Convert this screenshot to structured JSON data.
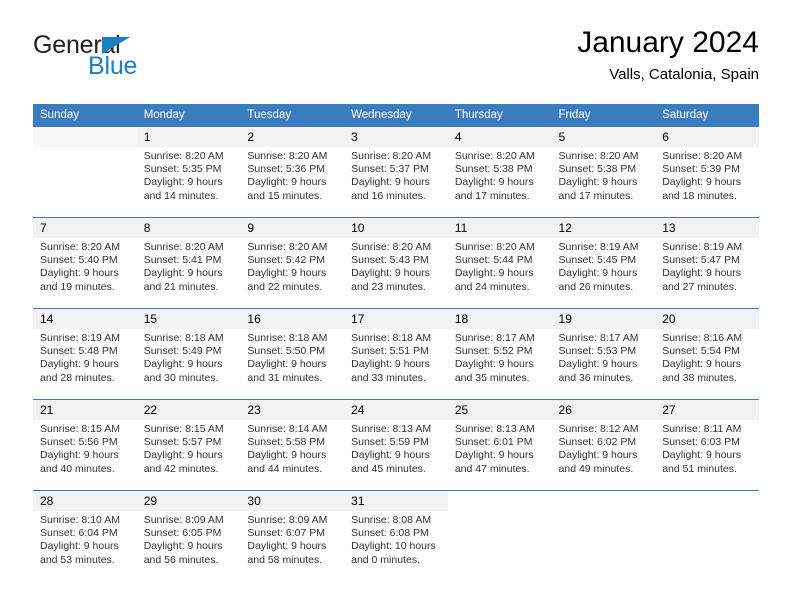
{
  "brand": {
    "name_part1": "General",
    "name_part2": "Blue",
    "triangle_color": "#1b7fc3"
  },
  "header": {
    "title": "January 2024",
    "location": "Valls, Catalonia, Spain"
  },
  "theme": {
    "header_bg": "#3b7cbf",
    "daynum_bg": "#f2f2f2",
    "text": "#333333"
  },
  "weekdays": [
    "Sunday",
    "Monday",
    "Tuesday",
    "Wednesday",
    "Thursday",
    "Friday",
    "Saturday"
  ],
  "labels": {
    "sunrise_prefix": "Sunrise:",
    "sunset_prefix": "Sunset:",
    "daylight_prefix": "Daylight:"
  },
  "weeks": [
    [
      {
        "day": "",
        "sunrise": "",
        "sunset": "",
        "daylight_line1": "",
        "daylight_line2": ""
      },
      {
        "day": "1",
        "sunrise": "Sunrise: 8:20 AM",
        "sunset": "Sunset: 5:35 PM",
        "daylight_line1": "Daylight: 9 hours",
        "daylight_line2": "and 14 minutes."
      },
      {
        "day": "2",
        "sunrise": "Sunrise: 8:20 AM",
        "sunset": "Sunset: 5:36 PM",
        "daylight_line1": "Daylight: 9 hours",
        "daylight_line2": "and 15 minutes."
      },
      {
        "day": "3",
        "sunrise": "Sunrise: 8:20 AM",
        "sunset": "Sunset: 5:37 PM",
        "daylight_line1": "Daylight: 9 hours",
        "daylight_line2": "and 16 minutes."
      },
      {
        "day": "4",
        "sunrise": "Sunrise: 8:20 AM",
        "sunset": "Sunset: 5:38 PM",
        "daylight_line1": "Daylight: 9 hours",
        "daylight_line2": "and 17 minutes."
      },
      {
        "day": "5",
        "sunrise": "Sunrise: 8:20 AM",
        "sunset": "Sunset: 5:38 PM",
        "daylight_line1": "Daylight: 9 hours",
        "daylight_line2": "and 17 minutes."
      },
      {
        "day": "6",
        "sunrise": "Sunrise: 8:20 AM",
        "sunset": "Sunset: 5:39 PM",
        "daylight_line1": "Daylight: 9 hours",
        "daylight_line2": "and 18 minutes."
      }
    ],
    [
      {
        "day": "7",
        "sunrise": "Sunrise: 8:20 AM",
        "sunset": "Sunset: 5:40 PM",
        "daylight_line1": "Daylight: 9 hours",
        "daylight_line2": "and 19 minutes."
      },
      {
        "day": "8",
        "sunrise": "Sunrise: 8:20 AM",
        "sunset": "Sunset: 5:41 PM",
        "daylight_line1": "Daylight: 9 hours",
        "daylight_line2": "and 21 minutes."
      },
      {
        "day": "9",
        "sunrise": "Sunrise: 8:20 AM",
        "sunset": "Sunset: 5:42 PM",
        "daylight_line1": "Daylight: 9 hours",
        "daylight_line2": "and 22 minutes."
      },
      {
        "day": "10",
        "sunrise": "Sunrise: 8:20 AM",
        "sunset": "Sunset: 5:43 PM",
        "daylight_line1": "Daylight: 9 hours",
        "daylight_line2": "and 23 minutes."
      },
      {
        "day": "11",
        "sunrise": "Sunrise: 8:20 AM",
        "sunset": "Sunset: 5:44 PM",
        "daylight_line1": "Daylight: 9 hours",
        "daylight_line2": "and 24 minutes."
      },
      {
        "day": "12",
        "sunrise": "Sunrise: 8:19 AM",
        "sunset": "Sunset: 5:45 PM",
        "daylight_line1": "Daylight: 9 hours",
        "daylight_line2": "and 26 minutes."
      },
      {
        "day": "13",
        "sunrise": "Sunrise: 8:19 AM",
        "sunset": "Sunset: 5:47 PM",
        "daylight_line1": "Daylight: 9 hours",
        "daylight_line2": "and 27 minutes."
      }
    ],
    [
      {
        "day": "14",
        "sunrise": "Sunrise: 8:19 AM",
        "sunset": "Sunset: 5:48 PM",
        "daylight_line1": "Daylight: 9 hours",
        "daylight_line2": "and 28 minutes."
      },
      {
        "day": "15",
        "sunrise": "Sunrise: 8:18 AM",
        "sunset": "Sunset: 5:49 PM",
        "daylight_line1": "Daylight: 9 hours",
        "daylight_line2": "and 30 minutes."
      },
      {
        "day": "16",
        "sunrise": "Sunrise: 8:18 AM",
        "sunset": "Sunset: 5:50 PM",
        "daylight_line1": "Daylight: 9 hours",
        "daylight_line2": "and 31 minutes."
      },
      {
        "day": "17",
        "sunrise": "Sunrise: 8:18 AM",
        "sunset": "Sunset: 5:51 PM",
        "daylight_line1": "Daylight: 9 hours",
        "daylight_line2": "and 33 minutes."
      },
      {
        "day": "18",
        "sunrise": "Sunrise: 8:17 AM",
        "sunset": "Sunset: 5:52 PM",
        "daylight_line1": "Daylight: 9 hours",
        "daylight_line2": "and 35 minutes."
      },
      {
        "day": "19",
        "sunrise": "Sunrise: 8:17 AM",
        "sunset": "Sunset: 5:53 PM",
        "daylight_line1": "Daylight: 9 hours",
        "daylight_line2": "and 36 minutes."
      },
      {
        "day": "20",
        "sunrise": "Sunrise: 8:16 AM",
        "sunset": "Sunset: 5:54 PM",
        "daylight_line1": "Daylight: 9 hours",
        "daylight_line2": "and 38 minutes."
      }
    ],
    [
      {
        "day": "21",
        "sunrise": "Sunrise: 8:15 AM",
        "sunset": "Sunset: 5:56 PM",
        "daylight_line1": "Daylight: 9 hours",
        "daylight_line2": "and 40 minutes."
      },
      {
        "day": "22",
        "sunrise": "Sunrise: 8:15 AM",
        "sunset": "Sunset: 5:57 PM",
        "daylight_line1": "Daylight: 9 hours",
        "daylight_line2": "and 42 minutes."
      },
      {
        "day": "23",
        "sunrise": "Sunrise: 8:14 AM",
        "sunset": "Sunset: 5:58 PM",
        "daylight_line1": "Daylight: 9 hours",
        "daylight_line2": "and 44 minutes."
      },
      {
        "day": "24",
        "sunrise": "Sunrise: 8:13 AM",
        "sunset": "Sunset: 5:59 PM",
        "daylight_line1": "Daylight: 9 hours",
        "daylight_line2": "and 45 minutes."
      },
      {
        "day": "25",
        "sunrise": "Sunrise: 8:13 AM",
        "sunset": "Sunset: 6:01 PM",
        "daylight_line1": "Daylight: 9 hours",
        "daylight_line2": "and 47 minutes."
      },
      {
        "day": "26",
        "sunrise": "Sunrise: 8:12 AM",
        "sunset": "Sunset: 6:02 PM",
        "daylight_line1": "Daylight: 9 hours",
        "daylight_line2": "and 49 minutes."
      },
      {
        "day": "27",
        "sunrise": "Sunrise: 8:11 AM",
        "sunset": "Sunset: 6:03 PM",
        "daylight_line1": "Daylight: 9 hours",
        "daylight_line2": "and 51 minutes."
      }
    ],
    [
      {
        "day": "28",
        "sunrise": "Sunrise: 8:10 AM",
        "sunset": "Sunset: 6:04 PM",
        "daylight_line1": "Daylight: 9 hours",
        "daylight_line2": "and 53 minutes."
      },
      {
        "day": "29",
        "sunrise": "Sunrise: 8:09 AM",
        "sunset": "Sunset: 6:05 PM",
        "daylight_line1": "Daylight: 9 hours",
        "daylight_line2": "and 56 minutes."
      },
      {
        "day": "30",
        "sunrise": "Sunrise: 8:09 AM",
        "sunset": "Sunset: 6:07 PM",
        "daylight_line1": "Daylight: 9 hours",
        "daylight_line2": "and 58 minutes."
      },
      {
        "day": "31",
        "sunrise": "Sunrise: 8:08 AM",
        "sunset": "Sunset: 6:08 PM",
        "daylight_line1": "Daylight: 10 hours",
        "daylight_line2": "and 0 minutes."
      },
      {
        "day": "",
        "sunrise": "",
        "sunset": "",
        "daylight_line1": "",
        "daylight_line2": ""
      },
      {
        "day": "",
        "sunrise": "",
        "sunset": "",
        "daylight_line1": "",
        "daylight_line2": ""
      },
      {
        "day": "",
        "sunrise": "",
        "sunset": "",
        "daylight_line1": "",
        "daylight_line2": ""
      }
    ]
  ]
}
